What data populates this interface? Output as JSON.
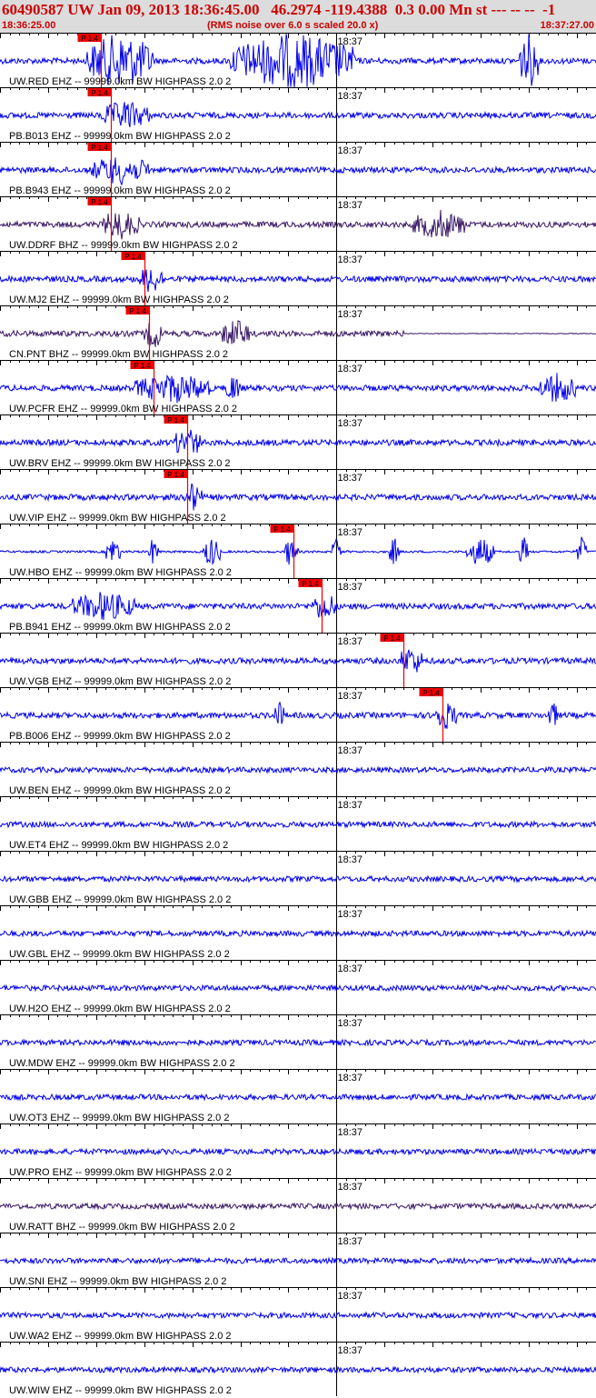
{
  "header": {
    "title": "60490587 UW Jan 09, 2013 18:36:45.00   46.2974 -119.4388  0.3 0.00 Mn st --- -- --  -1",
    "start_time": "18:36:25.00",
    "noise_note": "(RMS noise over 6.0 s scaled 20.0 x)",
    "end_time": "18:37:27.00"
  },
  "colors": {
    "header_bg": "#dcdcdc",
    "header_text": "#cc0000",
    "trace_default": "#0000ee",
    "trace_dark": "#3a1a66",
    "pick": "#ee0000"
  },
  "chart_data": {
    "type": "line",
    "x_unit": "seconds from 18:36:25.00",
    "xlim": [
      0,
      62
    ],
    "minute_mark": {
      "label": "18:37",
      "x": 35
    },
    "traces": [
      {
        "label": "UW.RED EHZ -- 99999.0km BW  HIGHPASS  2.0  2",
        "color": "blue",
        "pick": {
          "label": "P 1.4",
          "x": 10.5
        },
        "bursts": [
          [
            9,
            16
          ],
          [
            24,
            37
          ],
          [
            54,
            56
          ]
        ],
        "clipped": true
      },
      {
        "label": "PB.B013 EHZ -- 99999.0km BW  HIGHPASS  2.0  2",
        "color": "blue",
        "pick": {
          "label": "P 1.4",
          "x": 11.5
        },
        "bursts": [
          [
            10.5,
            15.5
          ]
        ]
      },
      {
        "label": "PB.B943 EHZ -- 99999.0km BW  HIGHPASS  2.0  2",
        "color": "blue",
        "pick": {
          "label": "P 1.4",
          "x": 11.5
        },
        "bursts": [
          [
            9.5,
            15.5
          ]
        ]
      },
      {
        "label": "UW.DDRF BHZ -- 99999.0km BW  HIGHPASS  2.0  2",
        "color": "dark",
        "pick": {
          "label": "P 1.4",
          "x": 11.5
        },
        "bursts": [
          [
            10.5,
            14.5
          ],
          [
            43,
            48.5
          ]
        ]
      },
      {
        "label": "UW.MJ2 EHZ -- 99999.0km BW  HIGHPASS  2.0  2",
        "color": "blue",
        "pick": {
          "label": "P 1.4",
          "x": 15
        },
        "bursts": [
          [
            14.5,
            17
          ]
        ]
      },
      {
        "label": "CN.PNT BHZ -- 99999.0km BW  HIGHPASS  2.0  2",
        "color": "dark",
        "pick": {
          "label": "P 1.4",
          "x": 15.5
        },
        "bursts": [
          [
            15,
            17
          ],
          [
            23,
            26
          ]
        ],
        "quiet_after": 42
      },
      {
        "label": "UW.PCFR EHZ -- 99999.0km BW  HIGHPASS  2.0  2",
        "color": "blue",
        "pick": {
          "label": "P 1.4",
          "x": 16
        },
        "bursts": [
          [
            14,
            22
          ],
          [
            23.5,
            25
          ],
          [
            56,
            60
          ]
        ]
      },
      {
        "label": "UW.BRV EHZ -- 99999.0km BW  HIGHPASS  2.0  2",
        "color": "blue",
        "pick": {
          "label": "P 1.4",
          "x": 19.5
        },
        "bursts": [
          [
            18,
            21
          ]
        ]
      },
      {
        "label": "UW.VIP EHZ -- 99999.0km BW  HIGHPASS  2.0  2",
        "color": "blue",
        "pick": {
          "label": "P 1.4",
          "x": 19.5
        },
        "bursts": [
          [
            19,
            21
          ]
        ]
      },
      {
        "label": "UW.HBO EHZ -- 99999.0km BW  HIGHPASS  2.0  2",
        "color": "blue",
        "pick": {
          "label": "P 1.4",
          "x": 30.5
        },
        "bursts": [
          [
            11,
            12.5
          ],
          [
            15.5,
            16.5
          ],
          [
            21,
            23
          ],
          [
            29.5,
            31
          ],
          [
            34.5,
            35.5
          ],
          [
            40.5,
            41.5
          ],
          [
            48.5,
            51.5
          ],
          [
            54,
            55
          ],
          [
            60,
            61
          ]
        ],
        "spiky": true
      },
      {
        "label": "PB.B941 EHZ -- 99999.0km BW  HIGHPASS  2.0  2",
        "color": "blue",
        "pick": {
          "label": "P 1.4",
          "x": 33.5
        },
        "bursts": [
          [
            7.5,
            14
          ],
          [
            32.5,
            35
          ]
        ]
      },
      {
        "label": "UW.VGB EHZ -- 99999.0km BW  HIGHPASS  2.0  2",
        "color": "blue",
        "pick": {
          "label": "P 1.4",
          "x": 42
        },
        "bursts": [
          [
            41.5,
            44
          ]
        ]
      },
      {
        "label": "PB.B006 EHZ -- 99999.0km BW  HIGHPASS  2.0  2",
        "color": "blue",
        "pick": {
          "label": "P 1.4",
          "x": 46
        },
        "bursts": [
          [
            28.5,
            29.5
          ],
          [
            45,
            47.5
          ],
          [
            57,
            58
          ]
        ]
      },
      {
        "label": "UW.BEN EHZ -- 99999.0km BW  HIGHPASS  2.0  2",
        "color": "blue",
        "bursts": []
      },
      {
        "label": "UW.ET4 EHZ -- 99999.0km BW  HIGHPASS  2.0  2",
        "color": "blue",
        "bursts": []
      },
      {
        "label": "UW.GBB EHZ -- 99999.0km BW  HIGHPASS  2.0  2",
        "color": "blue",
        "bursts": []
      },
      {
        "label": "UW.GBL EHZ -- 99999.0km BW  HIGHPASS  2.0  2",
        "color": "blue",
        "bursts": []
      },
      {
        "label": "UW.H2O EHZ -- 99999.0km BW  HIGHPASS  2.0  2",
        "color": "blue",
        "bursts": []
      },
      {
        "label": "UW.MDW EHZ -- 99999.0km BW  HIGHPASS  2.0  2",
        "color": "blue",
        "bursts": []
      },
      {
        "label": "UW.OT3 EHZ -- 99999.0km BW  HIGHPASS  2.0  2",
        "color": "blue",
        "bursts": []
      },
      {
        "label": "UW.PRO EHZ -- 99999.0km BW  HIGHPASS  2.0  2",
        "color": "blue",
        "bursts": []
      },
      {
        "label": "UW.RATT BHZ -- 99999.0km BW  HIGHPASS  2.0  2",
        "color": "dark",
        "bursts": []
      },
      {
        "label": "UW.SNI EHZ -- 99999.0km BW  HIGHPASS  2.0  2",
        "color": "blue",
        "bursts": []
      },
      {
        "label": "UW.WA2 EHZ -- 99999.0km BW  HIGHPASS  2.0  2",
        "color": "blue",
        "bursts": []
      },
      {
        "label": "UW.WIW EHZ -- 99999.0km BW  HIGHPASS  2.0  2",
        "color": "blue",
        "bursts": []
      }
    ]
  }
}
